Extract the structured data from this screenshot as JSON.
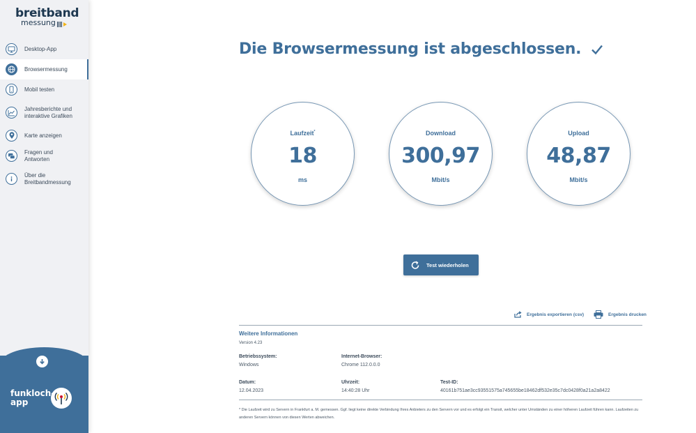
{
  "brand": {
    "line1": "breitband",
    "line2": "messung"
  },
  "sidebar": {
    "items": [
      {
        "label": "Desktop-App"
      },
      {
        "label": "Browsermessung"
      },
      {
        "label": "Mobil testen"
      },
      {
        "label": "Jahresberichte und interaktive Grafiken"
      },
      {
        "label": "Karte anzeigen"
      },
      {
        "label": "Fragen und Antworten"
      },
      {
        "label": "Über die Breitbandmessung"
      }
    ],
    "funkloch": {
      "line1": "funkloch-",
      "line2": "app"
    }
  },
  "main": {
    "title": "Die Browsermessung ist abgeschlossen.",
    "gauges": [
      {
        "label": "Laufzeit",
        "marker": "*",
        "value": "18",
        "unit": "ms"
      },
      {
        "label": "Download",
        "value": "300,97",
        "unit": "Mbit/s"
      },
      {
        "label": "Upload",
        "value": "48,87",
        "unit": "Mbit/s"
      }
    ],
    "retry_label": "Test wiederholen",
    "export_label": "Ergebnis exportieren (csv)",
    "print_label": "Ergebnis drucken",
    "info": {
      "title": "Weitere Informationen",
      "version": "Version 4.23",
      "os_label": "Betriebssystem:",
      "os_value": "Windows",
      "browser_label": "Internet-Browser:",
      "browser_value": "Chrome 112.0.0.0",
      "date_label": "Datum:",
      "date_value": "12.04.2023",
      "time_label": "Uhrzeit:",
      "time_value": "14:40:28 Uhr",
      "testid_label": "Test-ID:",
      "testid_value": "40161b751ae3cc93551575a745655be18462df532e35c7dc0428f0a21a2a8422"
    },
    "footnote": "* Die Laufzeit wird zu Servern in Frankfurt a. M. gemessen. Ggf. liegt keine direkte Verbindung Ihres Anbieters zu den Servern vor und es erfolgt ein Transit, welcher unter Umständen zu einer höheren Laufzeit führen kann. Laufzeiten zu anderen Servern können von diesen Werten abweichen."
  },
  "colors": {
    "accent": "#3f6f9a",
    "sidebar_bg": "#f0f1f4",
    "logo_yellow": "#f2b418",
    "text": "#3b4a5a"
  },
  "icons": [
    "monitor-icon",
    "globe-icon",
    "phone-icon",
    "chart-icon",
    "map-pin-icon",
    "chat-icon",
    "info-icon",
    "arrow-down-icon",
    "antenna-icon",
    "check-icon",
    "refresh-icon",
    "export-icon",
    "printer-icon"
  ]
}
